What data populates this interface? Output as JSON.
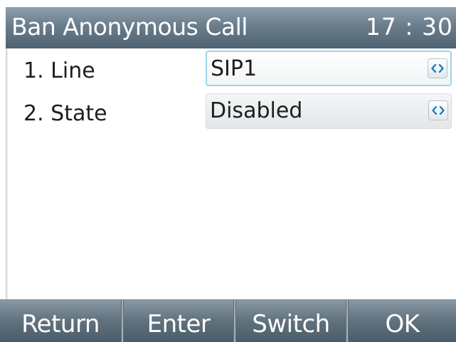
{
  "header": {
    "title": "Ban Anonymous Call",
    "time": "17 : 30"
  },
  "settings": [
    {
      "label": "1. Line",
      "value": "SIP1",
      "icon": "left-right-arrows-icon"
    },
    {
      "label": "2. State",
      "value": "Disabled",
      "icon": "left-right-arrows-icon"
    }
  ],
  "softkeys": {
    "return": "Return",
    "enter": "Enter",
    "switch": "Switch",
    "ok": "OK"
  },
  "colors": {
    "focus_border": "#9fd3ec",
    "arrow_icon": "#1a7fc0",
    "bar_top": "#8fa0ad",
    "bar_bottom": "#4f6372"
  }
}
